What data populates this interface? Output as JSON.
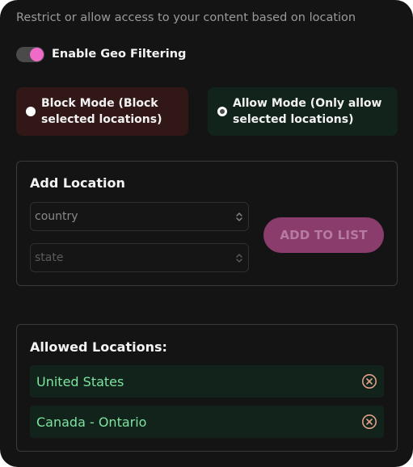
{
  "header": {
    "subtitle": "Restrict or allow access to your content based on location"
  },
  "geo_filter": {
    "label": "Enable Geo Filtering",
    "enabled": true,
    "accent_color": "#f06ac8"
  },
  "modes": [
    {
      "label": "Block Mode (Block selected locations)",
      "selected": false,
      "background": "#321717"
    },
    {
      "label": "Allow Mode (Only allow selected locations)",
      "selected": true,
      "background": "#11231a"
    }
  ],
  "add_location": {
    "title": "Add Location",
    "country_select": {
      "value": "country"
    },
    "state_select": {
      "value": "state"
    },
    "add_button_label": "ADD TO LIST",
    "button_color": "#8a3d6c"
  },
  "allowed": {
    "title": "Allowed Locations:",
    "items": [
      {
        "label": "United States"
      },
      {
        "label": "Canada - Ontario"
      }
    ],
    "item_text_color": "#7ee3a0",
    "remove_icon_color": "#e0a08a"
  }
}
